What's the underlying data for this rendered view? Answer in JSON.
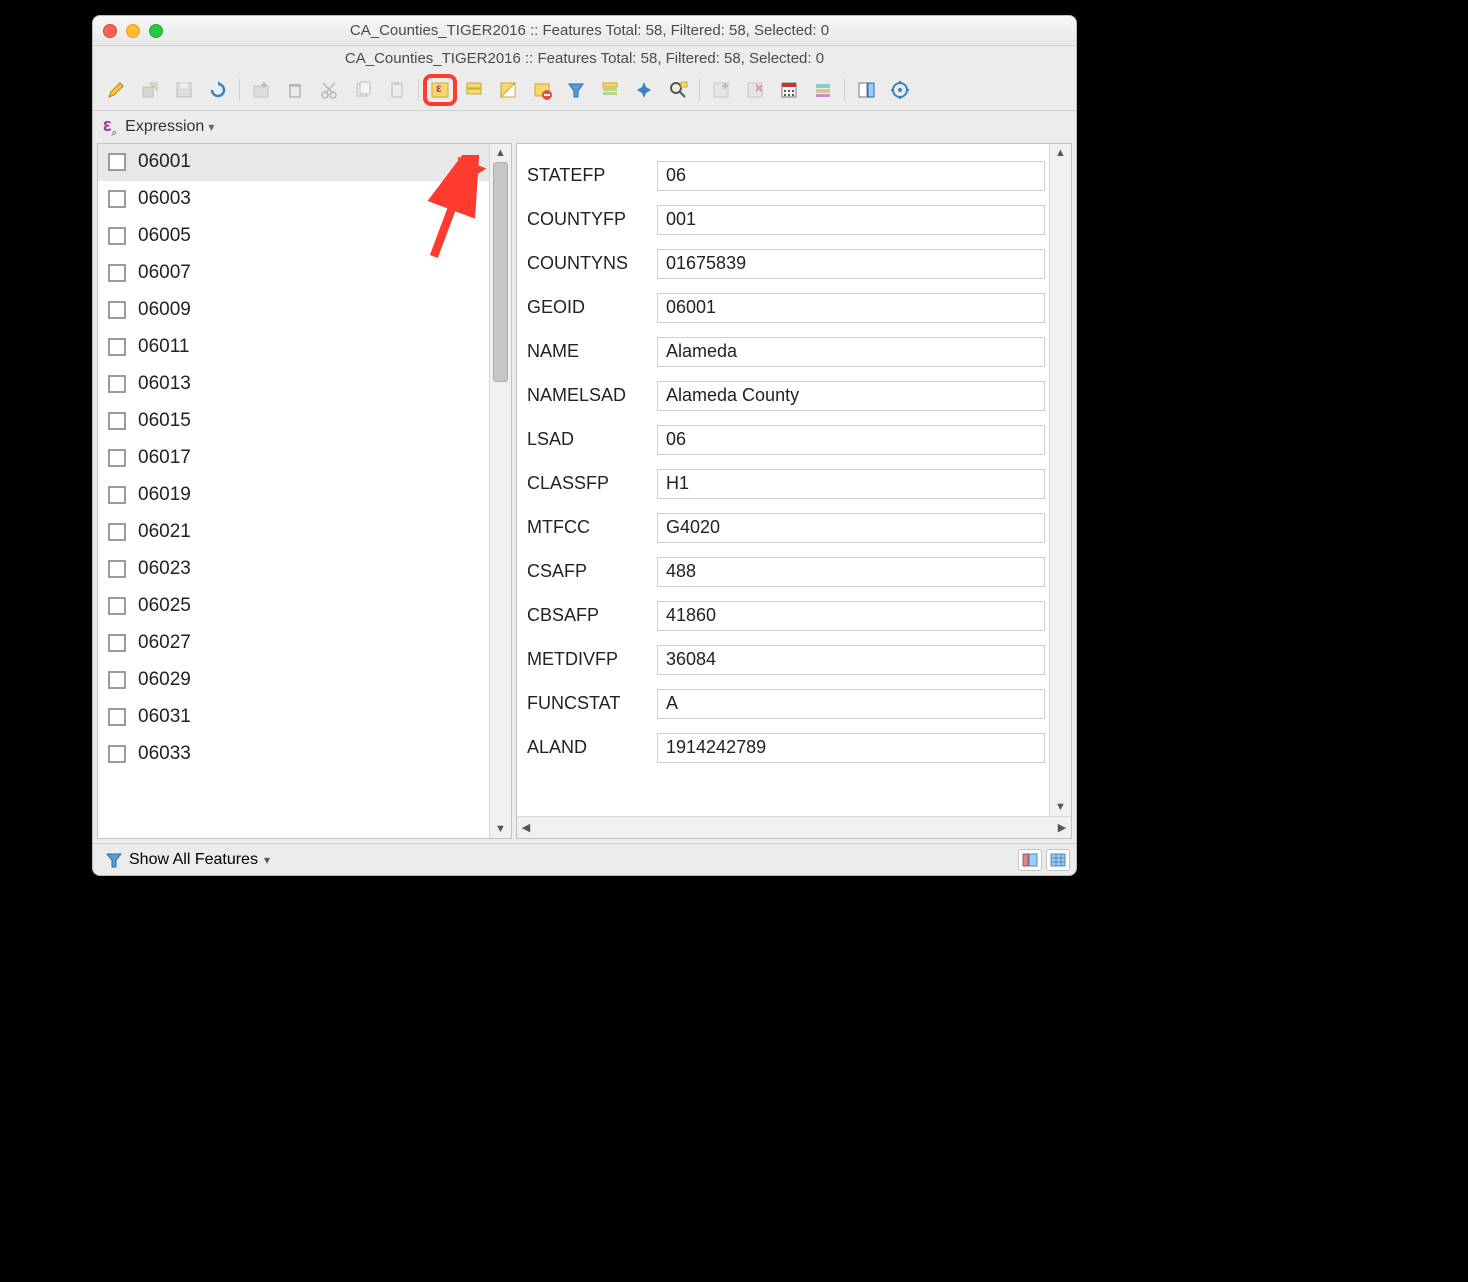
{
  "window": {
    "title": "CA_Counties_TIGER2016 :: Features Total: 58, Filtered: 58, Selected: 0",
    "subtitle": "CA_Counties_TIGER2016 :: Features Total: 58, Filtered: 58, Selected: 0"
  },
  "expression_label": "Expression",
  "feature_list": [
    "06001",
    "06003",
    "06005",
    "06007",
    "06009",
    "06011",
    "06013",
    "06015",
    "06017",
    "06019",
    "06021",
    "06023",
    "06025",
    "06027",
    "06029",
    "06031",
    "06033"
  ],
  "selected_feature": "06001",
  "attributes": [
    {
      "name": "STATEFP",
      "value": "06"
    },
    {
      "name": "COUNTYFP",
      "value": "001"
    },
    {
      "name": "COUNTYNS",
      "value": "01675839"
    },
    {
      "name": "GEOID",
      "value": "06001"
    },
    {
      "name": "NAME",
      "value": "Alameda"
    },
    {
      "name": "NAMELSAD",
      "value": "Alameda County"
    },
    {
      "name": "LSAD",
      "value": "06"
    },
    {
      "name": "CLASSFP",
      "value": "H1"
    },
    {
      "name": "MTFCC",
      "value": "G4020"
    },
    {
      "name": "CSAFP",
      "value": "488"
    },
    {
      "name": "CBSAFP",
      "value": "41860"
    },
    {
      "name": "METDIVFP",
      "value": "36084"
    },
    {
      "name": "FUNCSTAT",
      "value": "A"
    },
    {
      "name": "ALAND",
      "value": "1914242789"
    }
  ],
  "footer": {
    "show_all": "Show All Features"
  }
}
